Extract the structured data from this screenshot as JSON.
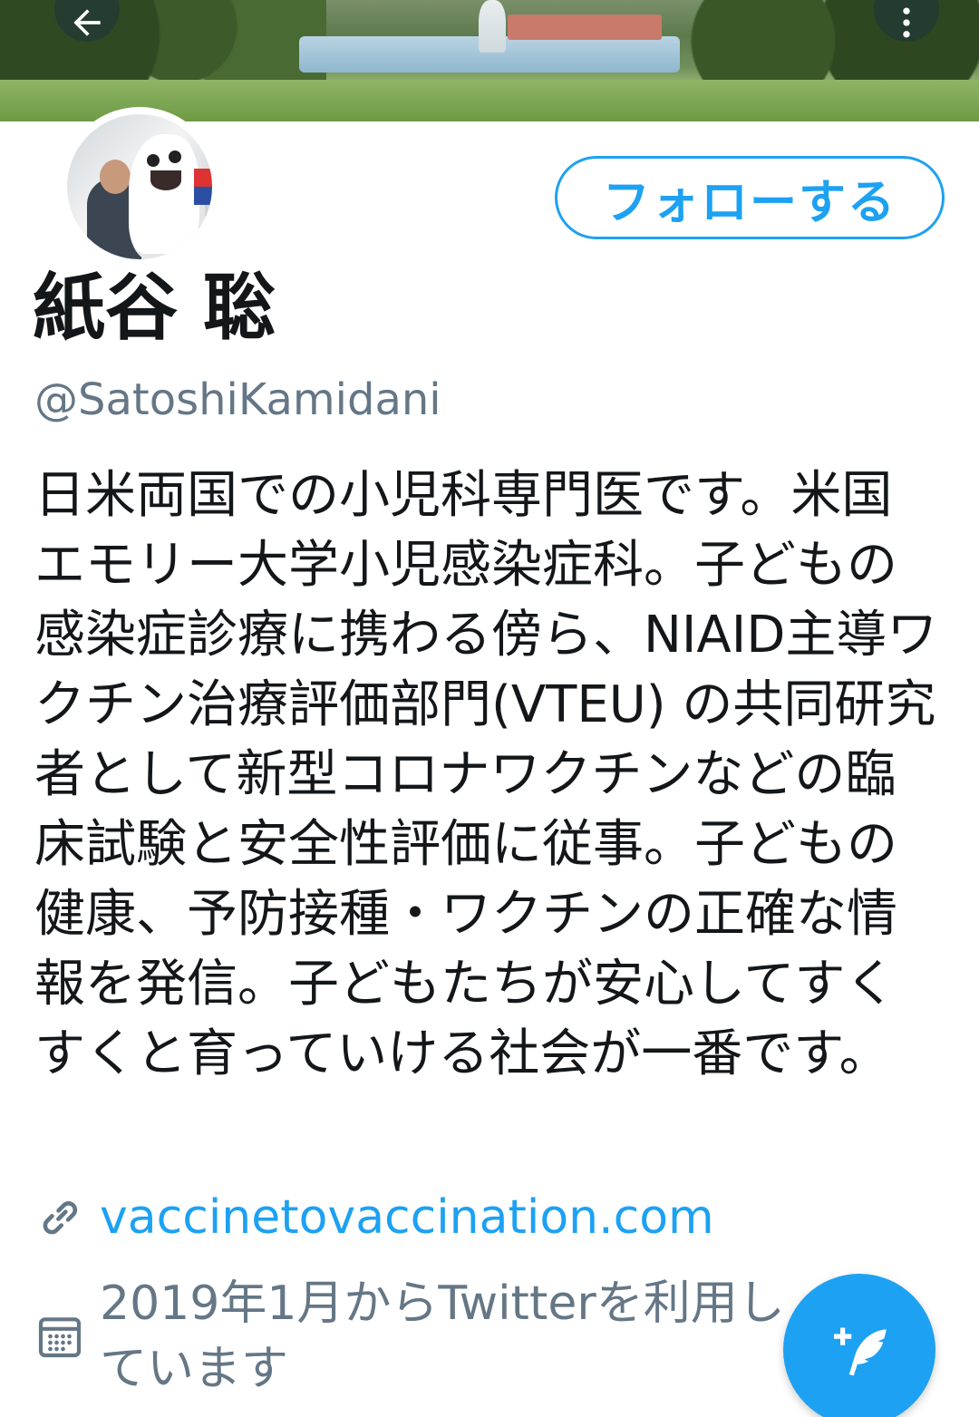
{
  "profile": {
    "name": "紙谷 聡",
    "handle": "@SatoshiKamidani",
    "bio": "日米両国での小児科専門医です。米国エモリー大学小児感染症科。子どもの感染症診療に携わる傍ら、NIAID主導ワクチン治療評価部門(VTEU) の共同研究者として新型コロナワクチンなどの臨床試験と安全性評価に従事。子どもの健康、予防接種・ワクチンの正確な情報を発信。子どもたちが安心してすくすくと育っていける社会が一番です。",
    "website": "vaccinetovaccination.com",
    "joined": "2019年1月からTwitterを利用しています"
  },
  "actions": {
    "follow_label": "フォローする"
  },
  "icons": {
    "back": "arrow-left-icon",
    "more": "more-vertical-icon",
    "link": "link-icon",
    "calendar": "calendar-icon",
    "compose": "compose-tweet-icon"
  },
  "colors": {
    "accent": "#1da1f2",
    "text": "#14171a",
    "secondary": "#657786"
  }
}
